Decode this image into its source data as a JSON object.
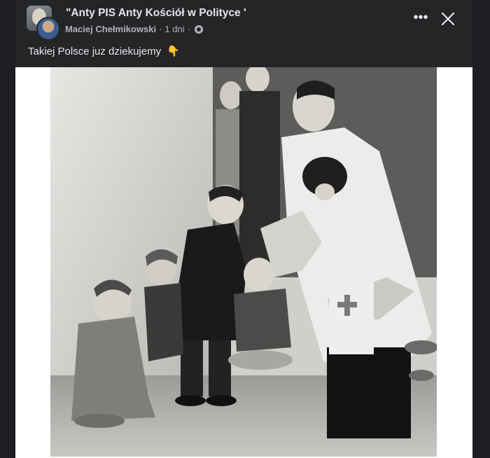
{
  "post": {
    "group_title": "\"Anty PIS Anty Kościół w Polityce '",
    "author": "Maciej Chełmikowski",
    "separator": "·",
    "time": "1 dni",
    "text": "Takiej Polsce juz dziekujemy",
    "emoji": "👇",
    "icons": {
      "more": "more-options-icon",
      "close": "close-icon",
      "audience": "globe-icon"
    }
  },
  "colors": {
    "background": "#242526",
    "text_primary": "#e4e6eb",
    "text_secondary": "#b0b3b8"
  }
}
